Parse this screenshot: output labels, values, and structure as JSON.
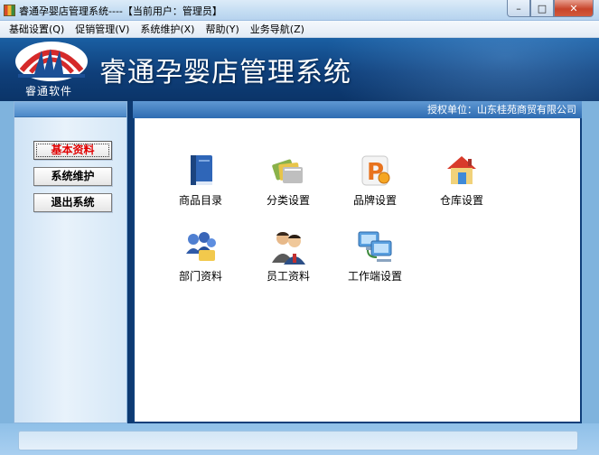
{
  "window": {
    "title": "睿通孕婴店管理系统----【当前用户：管理员】",
    "minimize_glyph": "–",
    "maximize_glyph": "□",
    "close_glyph": "✕"
  },
  "menu": [
    {
      "label": "基础设置(Q)"
    },
    {
      "label": "促销管理(V)"
    },
    {
      "label": "系统维护(X)"
    },
    {
      "label": "帮助(Y)"
    },
    {
      "label": "业务导航(Z)"
    }
  ],
  "banner": {
    "logo_caption": "睿通软件",
    "app_title": "睿通孕婴店管理系统"
  },
  "auth": {
    "text": "授权单位：山东桂苑商贸有限公司"
  },
  "nav": [
    {
      "label": "基本资料",
      "active": true
    },
    {
      "label": "系统维护",
      "active": false
    },
    {
      "label": "退出系统",
      "active": false
    }
  ],
  "tiles": [
    {
      "label": "商品目录",
      "icon": "book-icon"
    },
    {
      "label": "分类设置",
      "icon": "folders-icon"
    },
    {
      "label": "品牌设置",
      "icon": "brand-icon"
    },
    {
      "label": "仓库设置",
      "icon": "warehouse-icon"
    },
    {
      "label": "部门资料",
      "icon": "department-icon"
    },
    {
      "label": "员工资料",
      "icon": "employees-icon"
    },
    {
      "label": "工作端设置",
      "icon": "workstation-icon"
    }
  ],
  "colors": {
    "banner": "#0f3f7a",
    "active_nav_text": "#e00000",
    "content_bg": "#ffffff"
  }
}
